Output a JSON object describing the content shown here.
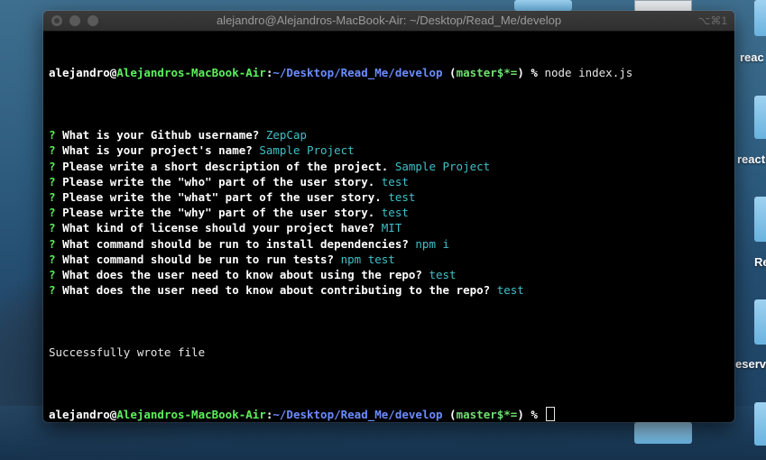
{
  "window": {
    "title": "alejandro@Alejandros-MacBook-Air: ~/Desktop/Read_Me/develop",
    "shortcut": "⌥⌘1"
  },
  "prompt": {
    "user": "alejandro",
    "at": "@",
    "host": "Alejandros-MacBook-Air",
    "colon": ":",
    "path": "~/Desktop/Read_Me/develop",
    "branch_open": " (",
    "branch": "master",
    "branch_status": "$*=",
    "branch_close": ")",
    "dollar": " % "
  },
  "command": "node index.js",
  "questions": [
    {
      "q": "?",
      "text": "What is your Github username?",
      "answer": "ZepCap"
    },
    {
      "q": "?",
      "text": "What is your project's name?",
      "answer": "Sample Project"
    },
    {
      "q": "?",
      "text": "Please write a short description of the project.",
      "answer": "Sample Project"
    },
    {
      "q": "?",
      "text": "Please write the \"who\" part of the user story.",
      "answer": "test"
    },
    {
      "q": "?",
      "text": "Please write the \"what\" part of the user story.",
      "answer": "test"
    },
    {
      "q": "?",
      "text": "Please write the \"why\" part of the user story.",
      "answer": "test"
    },
    {
      "q": "?",
      "text": "What kind of license should your project have?",
      "answer": "MIT"
    },
    {
      "q": "?",
      "text": "What command should be run to install dependencies?",
      "answer": "npm i"
    },
    {
      "q": "?",
      "text": "What command should be run to run tests?",
      "answer": "npm test"
    },
    {
      "q": "?",
      "text": "What does the user need to know about using the repo?",
      "answer": "test"
    },
    {
      "q": "?",
      "text": "What does the user need to know about contributing to the repo?",
      "answer": "test"
    }
  ],
  "result_message": "Successfully wrote file",
  "desktop": {
    "labels": [
      "reac",
      "react",
      "Re",
      "eserv"
    ]
  }
}
